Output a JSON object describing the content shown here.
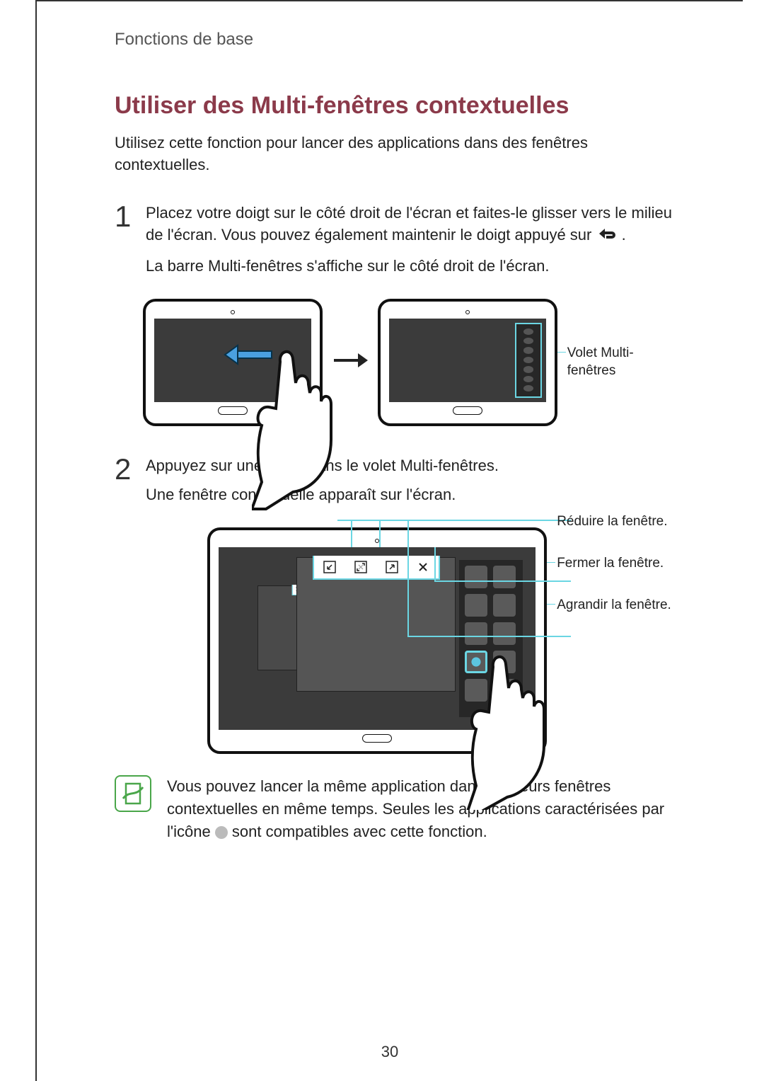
{
  "chapter": "Fonctions de base",
  "section_title": "Utiliser des Multi-fenêtres contextuelles",
  "intro": "Utilisez cette fonction pour lancer des applications dans des fenêtres contextuelles.",
  "steps": {
    "s1_num": "1",
    "s1_p1a": "Placez votre doigt sur le côté droit de l'écran et faites-le glisser vers le milieu de l'écran. Vous pouvez également maintenir le doigt appuyé sur ",
    "s1_p1b": ".",
    "s1_p2": "La barre Multi-fenêtres s'affiche sur le côté droit de l'écran.",
    "s2_num": "2",
    "s2_p1": "Appuyez sur une icône dans le volet Multi-fenêtres.",
    "s2_p2": "Une fenêtre contextuelle apparaît sur l'écran."
  },
  "callouts": {
    "fig1_right": "Volet Multi-fenêtres",
    "fig2_reduce": "Réduire la fenêtre.",
    "fig2_close": "Fermer la fenêtre.",
    "fig2_enlarge": "Agrandir la fenêtre."
  },
  "note": {
    "a": "Vous pouvez lancer la même application dans plusieurs fenêtres contextuelles en même temps. Seules les applications caractérisées par l'icône ",
    "b": " sont compatibles avec cette fonction."
  },
  "page_number": "30"
}
